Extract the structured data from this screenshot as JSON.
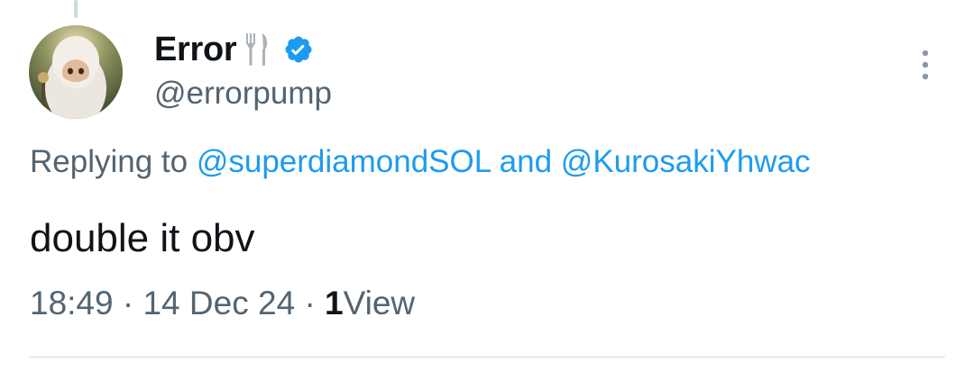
{
  "tweet": {
    "author": {
      "display_name": "Error",
      "name_emoji": "fork-and-knife-icon",
      "verified": true,
      "handle": "@errorpump",
      "avatar": "avatar-icon"
    },
    "reply_context": {
      "prefix": "Replying to",
      "mention_1": "@superdiamondSOL",
      "conjunction": "and",
      "mention_2": "@KurosakiYhwac"
    },
    "text": "double it obv",
    "meta": {
      "time": "18:49",
      "separator_1": "·",
      "date": "14 Dec 24",
      "separator_2": "·",
      "views_count": "1",
      "views_label": "View"
    },
    "more_icon": "more-vertical-icon"
  },
  "colors": {
    "text_primary": "#0f1419",
    "text_secondary": "#536471",
    "accent": "#1d9bf0",
    "divider": "#cfd9de"
  }
}
